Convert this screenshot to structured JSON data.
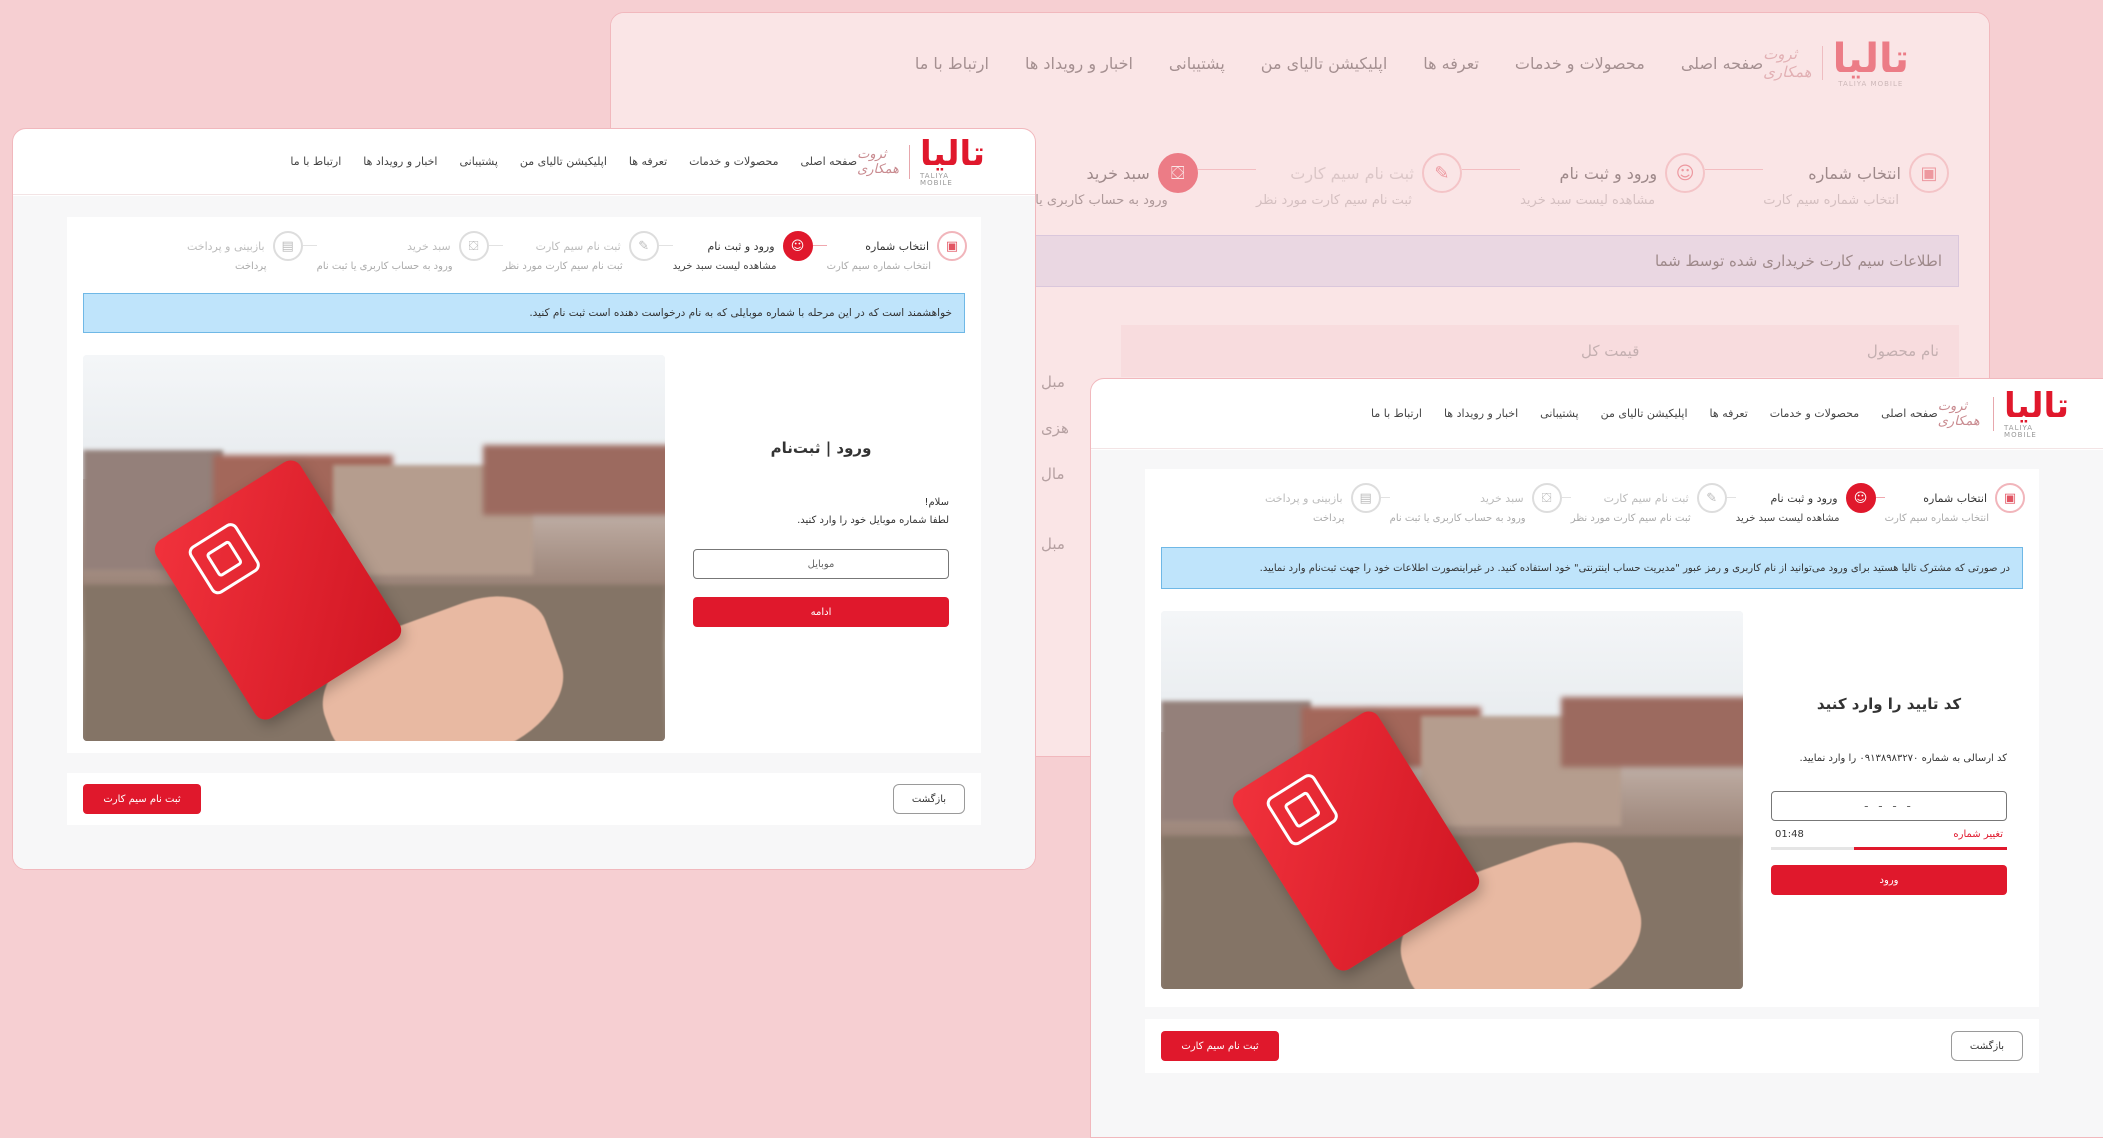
{
  "brand": {
    "logo": "تالیا",
    "logo_sub": "TALIYA MOBILE",
    "tagline": "ثروت همکاری"
  },
  "nav": [
    "صفحه اصلی",
    "محصولات و خدمات",
    "تعرفه ها",
    "اپلیکیشن تالیای من",
    "پشتیبانی",
    "اخبار و رویداد ها",
    "ارتباط با ما"
  ],
  "steps": [
    {
      "title": "انتخاب شماره",
      "sub": "انتخاب شماره سیم کارت"
    },
    {
      "title": "ورود و ثبت نام",
      "sub": "مشاهده لیست سبد خرید"
    },
    {
      "title": "ثبت نام سیم کارت",
      "sub": "ثبت نام سیم کارت مورد نظر"
    },
    {
      "title": "سبد خرید",
      "sub": "ورود به حساب کاربری یا ثبت نام"
    },
    {
      "title": "بازبینی و پرداخت",
      "sub": "پرداخت"
    }
  ],
  "back_window": {
    "info": "اطلاعات سیم کارت خریداری شده توسط شما",
    "col_product": "نام محصول",
    "col_total": "قیمت کل",
    "side": [
      "مبل",
      "هزی",
      "مال",
      "مبل"
    ]
  },
  "left_window": {
    "info": "خواهشمند است که در این مرحله با شماره موبایلی که به نام درخواست دهنده است ثبت نام کنید.",
    "form_title": "ورود | ثبت‌نام",
    "greeting": "سلام!",
    "prompt": "لطفا شماره موبایل خود را وارد کنید.",
    "input_placeholder": "موبایل",
    "continue": "ادامه",
    "back": "بازگشت",
    "register": "ثبت نام سیم کارت"
  },
  "right_window": {
    "info": "در صورتی که مشترک تالیا هستید برای ورود می‌توانید از نام کاربری و رمز عبور \"مدیریت حساب اینترنتی\" خود استفاده کنید. در غیراینصورت اطلاعات خود را جهت ثبت‌نام وارد نمایید.",
    "form_title": "کد تایید را وارد کنید",
    "prompt": "کد ارسالی به شماره ۰۹۱۳۸۹۸۳۲۷۰ را وارد نمایید.",
    "code_placeholder": "- - - -",
    "timer": "01:48",
    "change_number": "تغییر شماره",
    "timer_progress": 0.65,
    "login": "ورود",
    "back": "بازگشت",
    "register": "ثبت نام سیم کارت"
  },
  "colors": {
    "accent": "#e0182c",
    "page_bg": "#f6cfd2",
    "info_bg": "#bfe4fb"
  }
}
